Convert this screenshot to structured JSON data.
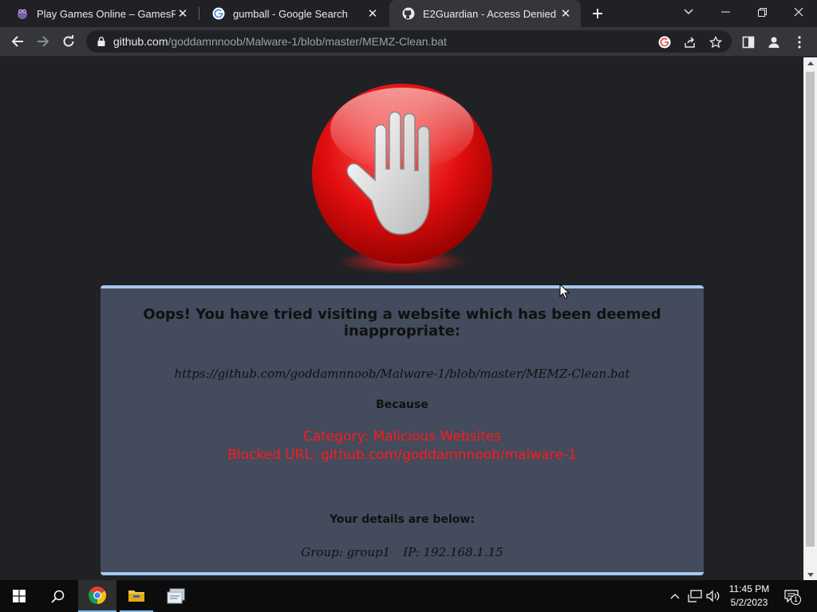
{
  "browser": {
    "tabs": [
      {
        "title": "Play Games Online – GamesFrog",
        "favicon": "frog-icon",
        "active": false
      },
      {
        "title": "gumball - Google Search",
        "favicon": "google-icon",
        "active": false
      },
      {
        "title": "E2Guardian - Access Denied",
        "favicon": "github-icon",
        "active": true
      }
    ],
    "address": {
      "host": "github.com",
      "path": "/goddamnnoob/Malware-1/blob/master/MEMZ-Clean.bat"
    }
  },
  "page": {
    "headline": "Oops! You have tried visiting a website which has been deemed inappropriate:",
    "blocked_full_url": "https://github.com/goddamnnoob/Malware-1/blob/master/MEMZ-Clean.bat",
    "because_label": "Because",
    "category_line": "Category: Malicious Websites",
    "blocked_url_line": "Blocked URL: github.com/goddamnnoob/malware-1",
    "details_label": "Your details are below:",
    "group_line": "Group: group1",
    "ip_line": "IP: 192.168.1.15",
    "accent_color": "#ff1a1a",
    "card_border_color": "#a7c8ef"
  },
  "taskbar": {
    "time": "11:45 PM",
    "date": "5/2/2023",
    "notification_count": "1"
  }
}
